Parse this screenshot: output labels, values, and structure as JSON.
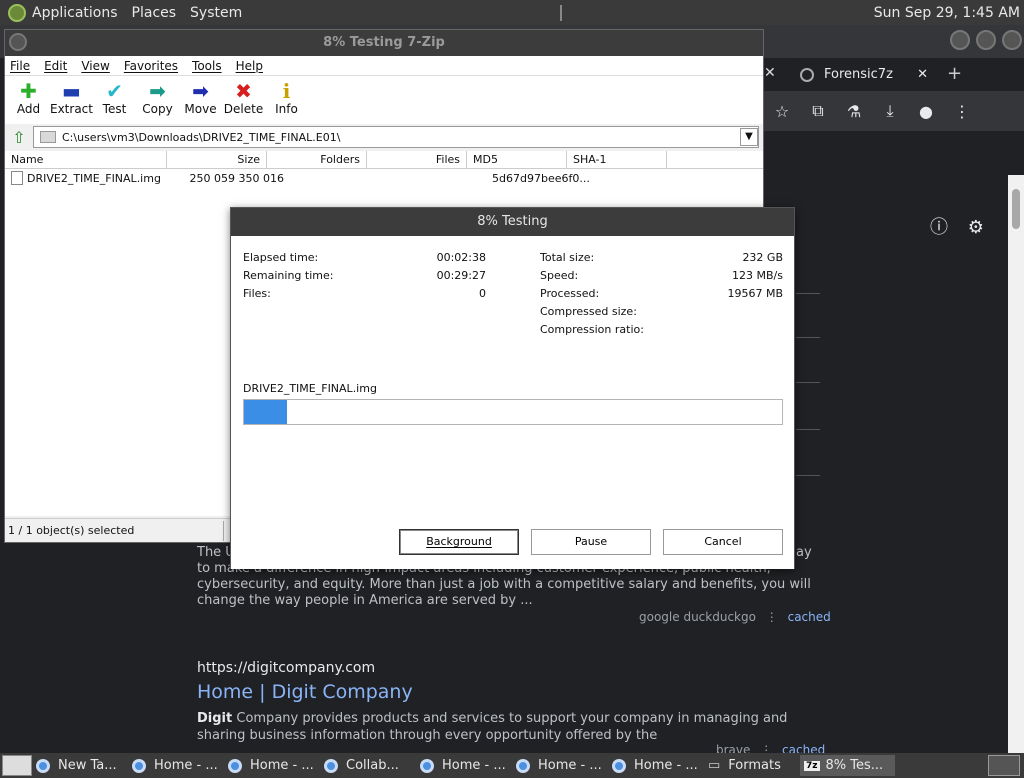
{
  "top_panel": {
    "menus": [
      "Applications",
      "Places",
      "System"
    ],
    "clock": "Sun Sep 29,  1:45 AM"
  },
  "browser": {
    "tab_title": "Forensic7z",
    "tab_close": "✕",
    "left_close": "✕",
    "new_tab": "+",
    "result1_snippet": "to make a difference in high-impact areas including customer experience, public health, cybersecurity, and equity. More than just a job with a competitive salary and benefits, you will change the way people in America are served by ...",
    "result1_line_start": "The U",
    "result1_line_end": "ay",
    "result1_meta_links": "google  duckduckgo",
    "result1_cached": "cached",
    "result2_url": "https://digitcompany.com",
    "result2_title": "Home | Digit Company",
    "result2_bold": "Digit",
    "result2_desc": " Company provides products and services to support your company in managing and sharing business information through every opportunity offered by the",
    "result2_meta": "brave",
    "result2_cached": "cached"
  },
  "zip": {
    "title": "8% Testing 7-Zip",
    "menu": [
      "File",
      "Edit",
      "View",
      "Favorites",
      "Tools",
      "Help"
    ],
    "tools": [
      {
        "label": "Add",
        "icon": "✚",
        "color": "#2bb02b"
      },
      {
        "label": "Extract",
        "icon": "▬",
        "color": "#1f3fb0"
      },
      {
        "label": "Test",
        "icon": "✔",
        "color": "#23b7c9"
      },
      {
        "label": "Copy",
        "icon": "➡",
        "color": "#1c9a8a"
      },
      {
        "label": "Move",
        "icon": "➡",
        "color": "#1f2fb0"
      },
      {
        "label": "Delete",
        "icon": "✖",
        "color": "#d62020"
      },
      {
        "label": "Info",
        "icon": "i",
        "color": "#c8a000"
      }
    ],
    "path": "C:\\users\\vm3\\Downloads\\DRIVE2_TIME_FINAL.E01\\",
    "columns": [
      "Name",
      "Size",
      "Folders",
      "Files",
      "MD5",
      "SHA-1"
    ],
    "rows": [
      {
        "name": "DRIVE2_TIME_FINAL.img",
        "size": "250 059 350 016",
        "folders": "",
        "files": "",
        "md5": "5d67d97bee6f0...",
        "sha1": ""
      }
    ],
    "status": "1 / 1 object(s) selected"
  },
  "dialog": {
    "title": "8% Testing",
    "left_labels": [
      "Elapsed time:",
      "Remaining time:",
      "Files:"
    ],
    "left_values": [
      "00:02:38",
      "00:29:27",
      "0"
    ],
    "right_labels": [
      "Total size:",
      "Speed:",
      "Processed:",
      "Compressed size:",
      "Compression ratio:"
    ],
    "right_values": [
      "232 GB",
      "123 MB/s",
      "19567 MB",
      "",
      ""
    ],
    "filename": "DRIVE2_TIME_FINAL.img",
    "progress_percent": 8,
    "progress_color": "#3a8ee6",
    "buttons": {
      "background": "Background",
      "pause": "Pause",
      "cancel": "Cancel"
    }
  },
  "taskbar": {
    "tasks": [
      "New Ta...",
      "Home - ...",
      "Home - ...",
      "Collab...",
      "Home - ...",
      "Home - ...",
      "Home - ...",
      "Formats",
      "8% Tes..."
    ]
  }
}
